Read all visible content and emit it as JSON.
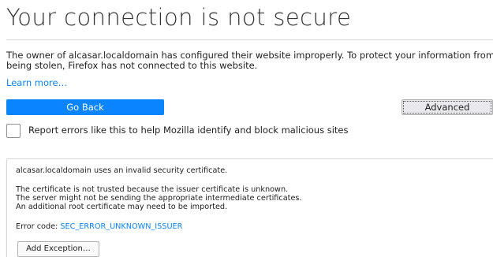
{
  "error_page": {
    "title": "Your connection is not secure",
    "description": "The owner of alcasar.localdomain has configured their website improperly. To protect your information from being stolen, Firefox has not connected to this website.",
    "learn_more": "Learn more…",
    "go_back_label": "Go Back",
    "advanced_label": "Advanced",
    "report_label": "Report errors like this to help Mozilla identify and block malicious sites"
  },
  "advanced_panel": {
    "summary": "alcasar.localdomain uses an invalid security certificate.",
    "reason_lines": [
      "The certificate is not trusted because the issuer certificate is unknown.",
      "The server might not be sending the appropriate intermediate certificates.",
      "An additional root certificate may need to be imported."
    ],
    "error_prefix": "Error code: ",
    "error_code": "SEC_ERROR_UNKNOWN_ISSUER",
    "add_exception_label": "Add Exception…"
  },
  "colors": {
    "accent": "#0a84ff",
    "text": "#222222",
    "border": "#d7d7db"
  }
}
